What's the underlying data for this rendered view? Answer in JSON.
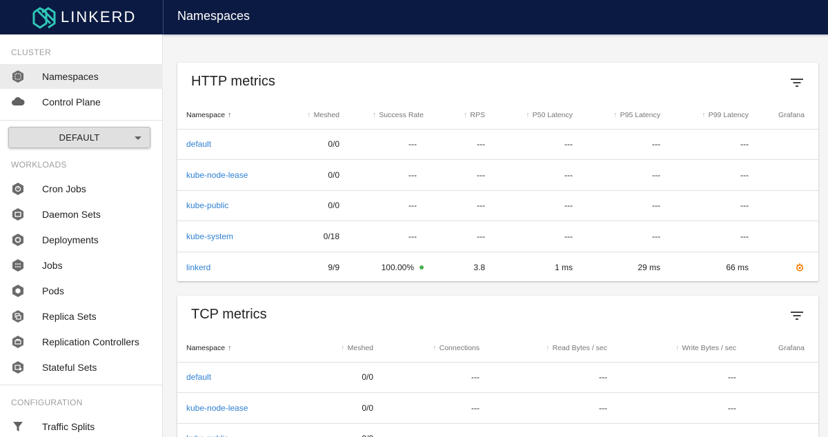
{
  "app": {
    "brand": "LINKERD",
    "page_title": "Namespaces"
  },
  "colors": {
    "topbar": "#0b1a42",
    "link": "#2f80d1",
    "success_dot": "#4caf50",
    "grafana": "#f57c00"
  },
  "sidebar": {
    "cluster_label": "CLUSTER",
    "cluster_items": [
      {
        "label": "Namespaces",
        "icon": "namespace-icon"
      },
      {
        "label": "Control Plane",
        "icon": "cloud-icon"
      }
    ],
    "namespace_select": "DEFAULT",
    "workloads_label": "WORKLOADS",
    "workload_items": [
      {
        "label": "Cron Jobs",
        "icon": "cronjob-icon"
      },
      {
        "label": "Daemon Sets",
        "icon": "daemonset-icon"
      },
      {
        "label": "Deployments",
        "icon": "deployment-icon"
      },
      {
        "label": "Jobs",
        "icon": "job-icon"
      },
      {
        "label": "Pods",
        "icon": "pod-icon"
      },
      {
        "label": "Replica Sets",
        "icon": "replicaset-icon"
      },
      {
        "label": "Replication Controllers",
        "icon": "replicationcontroller-icon"
      },
      {
        "label": "Stateful Sets",
        "icon": "statefulset-icon"
      }
    ],
    "configuration_label": "CONFIGURATION",
    "configuration_items": [
      {
        "label": "Traffic Splits",
        "icon": "filter-funnel-icon"
      }
    ]
  },
  "http": {
    "title": "HTTP metrics",
    "headers": [
      "Namespace",
      "Meshed",
      "Success Rate",
      "RPS",
      "P50 Latency",
      "P95 Latency",
      "P99 Latency",
      "Grafana"
    ],
    "rows": [
      {
        "namespace": "default",
        "meshed": "0/0",
        "success": "---",
        "rps": "---",
        "p50": "---",
        "p95": "---",
        "p99": "---"
      },
      {
        "namespace": "kube-node-lease",
        "meshed": "0/0",
        "success": "---",
        "rps": "---",
        "p50": "---",
        "p95": "---",
        "p99": "---"
      },
      {
        "namespace": "kube-public",
        "meshed": "0/0",
        "success": "---",
        "rps": "---",
        "p50": "---",
        "p95": "---",
        "p99": "---"
      },
      {
        "namespace": "kube-system",
        "meshed": "0/18",
        "success": "---",
        "rps": "---",
        "p50": "---",
        "p95": "---",
        "p99": "---"
      },
      {
        "namespace": "linkerd",
        "meshed": "9/9",
        "success": "100.00%",
        "rps": "3.8",
        "p50": "1 ms",
        "p95": "29 ms",
        "p99": "66 ms"
      }
    ]
  },
  "tcp": {
    "title": "TCP metrics",
    "headers": [
      "Namespace",
      "Meshed",
      "Connections",
      "Read Bytes / sec",
      "Write Bytes / sec",
      "Grafana"
    ],
    "rows": [
      {
        "namespace": "default",
        "meshed": "0/0",
        "connections": "---",
        "read": "---",
        "write": "---"
      },
      {
        "namespace": "kube-node-lease",
        "meshed": "0/0",
        "connections": "---",
        "read": "---",
        "write": "---"
      },
      {
        "namespace": "kube-public",
        "meshed": "0/0",
        "connections": "---",
        "read": "---",
        "write": "---"
      }
    ]
  }
}
